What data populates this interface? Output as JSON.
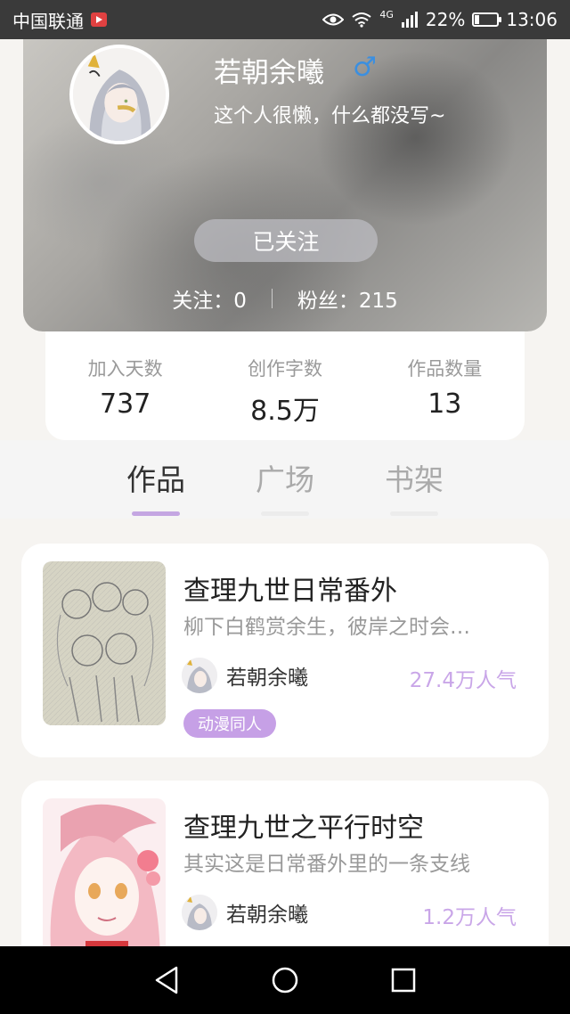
{
  "status_bar": {
    "carrier": "中国联通",
    "signal_label": "4G",
    "battery_percent": "22%",
    "battery_level": 0.22,
    "time": "13:06"
  },
  "profile": {
    "username": "若朝余曦",
    "gender_symbol": "♂",
    "bio": "这个人很懒，什么都没写~",
    "follow_button": "已关注",
    "following_label": "关注：0",
    "followers_label": "粉丝：215"
  },
  "info": [
    {
      "label": "加入天数",
      "value": "737"
    },
    {
      "label": "创作字数",
      "value": "8.5万"
    },
    {
      "label": "作品数量",
      "value": "13"
    }
  ],
  "tabs": [
    "作品",
    "广场",
    "书架"
  ],
  "works": [
    {
      "title": "查理九世日常番外",
      "description": "柳下白鹤赏余生，彼岸之时会…",
      "author": "若朝余曦",
      "popularity": "27.4万人气",
      "tag": "动漫同人"
    },
    {
      "title": "查理九世之平行时空",
      "description": "其实这是日常番外里的一条支线",
      "author": "若朝余曦",
      "popularity": "1.2万人气"
    }
  ],
  "colors": {
    "accent": "#c4a6e2",
    "popularity": "#c9a6e8",
    "gender": "#3b8fe0"
  }
}
